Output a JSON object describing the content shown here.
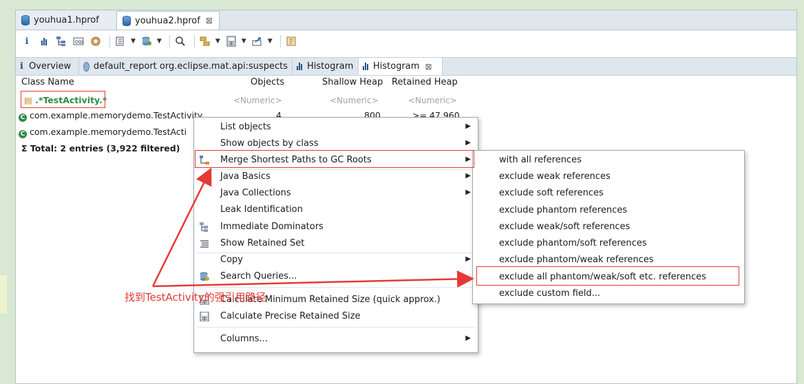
{
  "file_tabs": [
    {
      "label": "youhua1.hprof",
      "active": false
    },
    {
      "label": "youhua2.hprof",
      "active": true,
      "close": "⊠"
    }
  ],
  "view_tabs": [
    {
      "label": "Overview"
    },
    {
      "label": "default_report  org.eclipse.mat.api:suspects"
    },
    {
      "label": "Histogram"
    },
    {
      "label": "Histogram",
      "active": true,
      "close": "⊠"
    }
  ],
  "table": {
    "headers": [
      "Class Name",
      "Objects",
      "Shallow Heap",
      "Retained Heap"
    ],
    "filter_row": {
      "class_regex": ".*TestActivity.*",
      "objects": "<Numeric>",
      "shallow": "<Numeric>",
      "retained": "<Numeric>"
    },
    "rows": [
      {
        "class": "com.example.memorydemo.TestActivity",
        "objects": "4",
        "shallow": "800",
        "retained": ">= 47,960"
      },
      {
        "class": "com.example.memorydemo.TestActi"
      }
    ],
    "total": "Total: 2 entries (3,922 filtered)"
  },
  "context_menu": {
    "items": [
      {
        "label": "List objects",
        "submenu": true
      },
      {
        "label": "Show objects by class",
        "submenu": true
      },
      {
        "label": "Merge Shortest Paths to GC Roots",
        "submenu": true,
        "icon": "paths-icon"
      },
      {
        "label": "Java Basics",
        "submenu": true
      },
      {
        "label": "Java Collections",
        "submenu": true
      },
      {
        "label": "Leak Identification",
        "submenu": false
      },
      {
        "label": "Immediate Dominators",
        "submenu": false,
        "icon": "dominators-icon"
      },
      {
        "label": "Show Retained Set",
        "submenu": false,
        "icon": "retained-set-icon"
      },
      {
        "label": "Copy",
        "submenu": true
      },
      {
        "label": "Search Queries...",
        "submenu": false,
        "icon": "search-queries-icon"
      },
      {
        "label": "Calculate Minimum Retained Size (quick approx.)",
        "submenu": false,
        "icon": "calculator-icon"
      },
      {
        "label": "Calculate Precise Retained Size",
        "submenu": false,
        "icon": "calculator-icon"
      },
      {
        "label": "Columns...",
        "submenu": true
      }
    ]
  },
  "submenu": {
    "items": [
      "with all references",
      "exclude weak references",
      "exclude soft references",
      "exclude phantom references",
      "exclude weak/soft references",
      "exclude phantom/soft references",
      "exclude phantom/weak references",
      "exclude all phantom/weak/soft etc. references",
      "exclude custom field..."
    ]
  },
  "annotation": {
    "text": "找到TestActivity的强引用路径"
  },
  "colors": {
    "annotation_red": "#e53935",
    "background": "#d9e8d3"
  }
}
